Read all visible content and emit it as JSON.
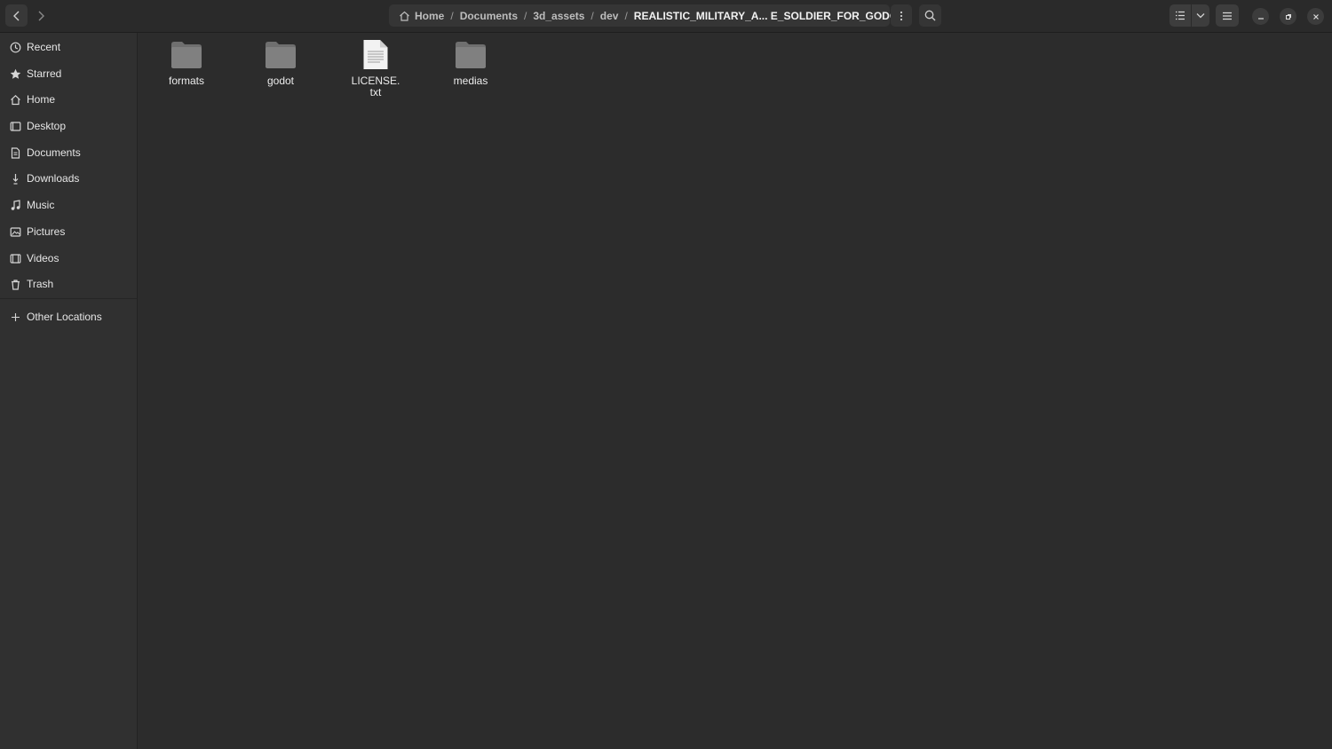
{
  "headerbar": {
    "breadcrumb": [
      {
        "label": "Home",
        "icon": "home-icon"
      },
      {
        "label": "Documents"
      },
      {
        "label": "3d_assets"
      },
      {
        "label": "dev"
      },
      {
        "label": "REALISTIC_MILITARY_A... E_SOLDIER_FOR_GODOT"
      }
    ],
    "separator": "/"
  },
  "sidebar": {
    "items": [
      {
        "label": "Recent",
        "icon": "clock-icon"
      },
      {
        "label": "Starred",
        "icon": "star-icon"
      },
      {
        "label": "Home",
        "icon": "home-icon"
      },
      {
        "label": "Desktop",
        "icon": "desktop-icon"
      },
      {
        "label": "Documents",
        "icon": "document-icon"
      },
      {
        "label": "Downloads",
        "icon": "download-icon"
      },
      {
        "label": "Music",
        "icon": "music-icon"
      },
      {
        "label": "Pictures",
        "icon": "picture-icon"
      },
      {
        "label": "Videos",
        "icon": "video-icon"
      },
      {
        "label": "Trash",
        "icon": "trash-icon"
      },
      {
        "label": "Other Locations",
        "icon": "plus-icon"
      }
    ]
  },
  "files": [
    {
      "name": "formats",
      "type": "folder"
    },
    {
      "name": "godot",
      "type": "folder"
    },
    {
      "name_line1": "LICENSE.",
      "name_line2": "txt",
      "type": "text-file"
    },
    {
      "name": "medias",
      "type": "folder"
    }
  ],
  "colors": {
    "background": "#2c2c2c",
    "sidebar": "#303030",
    "folder": "#7b7b7b",
    "text": "#e8e8e8"
  }
}
